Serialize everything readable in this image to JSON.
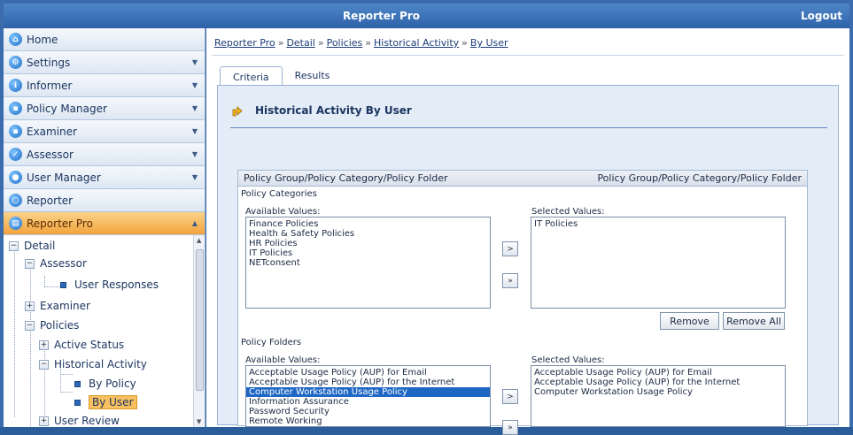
{
  "app": {
    "title": "Reporter Pro",
    "logout_label": "Logout"
  },
  "sidebar": {
    "items": [
      {
        "label": "Home",
        "icon": "home-icon",
        "glyph": "⌂",
        "arrow": ""
      },
      {
        "label": "Settings",
        "icon": "settings-icon",
        "glyph": "⚙",
        "arrow": "▼"
      },
      {
        "label": "Informer",
        "icon": "info-icon",
        "glyph": "i",
        "arrow": "▼"
      },
      {
        "label": "Policy Manager",
        "icon": "policy-manager-icon",
        "glyph": "▪",
        "arrow": "▼"
      },
      {
        "label": "Examiner",
        "icon": "examiner-icon",
        "glyph": "▪",
        "arrow": "▼"
      },
      {
        "label": "Assessor",
        "icon": "assessor-icon",
        "glyph": "✓",
        "arrow": "▼"
      },
      {
        "label": "User Manager",
        "icon": "user-manager-icon",
        "glyph": "●",
        "arrow": "▼"
      },
      {
        "label": "Reporter",
        "icon": "reporter-icon",
        "glyph": "○",
        "arrow": ""
      },
      {
        "label": "Reporter Pro",
        "icon": "reporter-pro-icon",
        "glyph": "▤",
        "arrow": "▲"
      }
    ],
    "tree": {
      "detail": "Detail",
      "assessor": "Assessor",
      "user_responses": "User Responses",
      "examiner": "Examiner",
      "policies": "Policies",
      "active_status": "Active Status",
      "historical_activity": "Historical Activity",
      "by_policy": "By Policy",
      "by_user": "By User",
      "user_review": "User Review"
    }
  },
  "breadcrumb": [
    "Reporter Pro",
    "Detail",
    "Policies",
    "Historical Activity",
    "By User"
  ],
  "breadcrumb_sep": "»",
  "tabs": [
    "Criteria",
    "Results"
  ],
  "panel": {
    "title": "Historical Activity By User",
    "group_left": "Policy Group/Policy Category/Policy Folder",
    "group_right": "Policy Group/Policy Category/Policy Folder",
    "categories": {
      "section_label": "Policy Categories",
      "available_label": "Available Values:",
      "selected_label": "Selected Values:",
      "available": [
        "Finance Policies",
        "Health & Safety Policies",
        "HR Policies",
        "IT Policies",
        "NETconsent"
      ],
      "selected": [
        "IT Policies"
      ]
    },
    "folders": {
      "section_label": "Policy Folders",
      "available_label": "Available Values:",
      "selected_label": "Selected Values:",
      "available": [
        "Acceptable Usage Policy (AUP) for Email",
        "Acceptable Usage Policy (AUP) for the Internet",
        "Computer Workstation Usage Policy",
        "Information Assurance",
        "Password Security",
        "Remote Working"
      ],
      "highlighted_index": 2,
      "selected": [
        "Acceptable Usage Policy (AUP) for Email",
        "Acceptable Usage Policy (AUP) for the Internet",
        "Computer Workstation Usage Policy"
      ]
    },
    "move_one": ">",
    "move_all": "»",
    "remove_label": "Remove",
    "remove_all_label": "Remove All"
  },
  "colors": {
    "accent": "#2d62a8",
    "active_nav": "#f2a33c",
    "selection": "#1e67c5"
  }
}
